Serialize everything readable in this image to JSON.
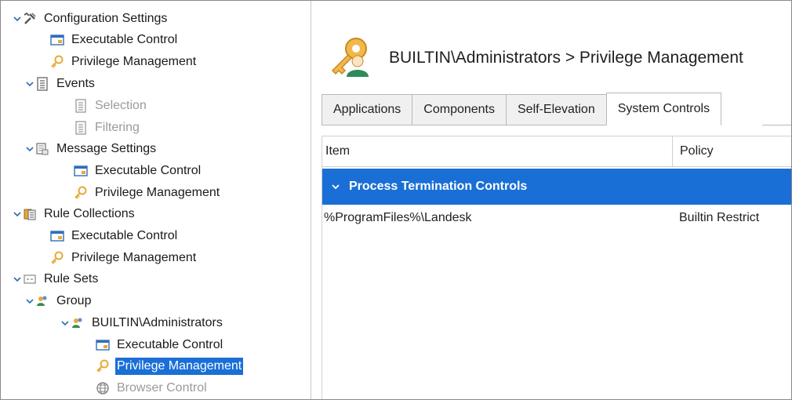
{
  "tree": {
    "config_settings": "Configuration Settings",
    "executable_control_1": "Executable Control",
    "privilege_management_1": "Privilege Management",
    "events": "Events",
    "selection": "Selection",
    "filtering": "Filtering",
    "message_settings": "Message Settings",
    "executable_control_2": "Executable Control",
    "privilege_management_2": "Privilege Management",
    "rule_collections": "Rule Collections",
    "executable_control_3": "Executable Control",
    "privilege_management_3": "Privilege Management",
    "rule_sets": "Rule Sets",
    "group": "Group",
    "builtin_admins": "BUILTIN\\Administrators",
    "executable_control_4": "Executable Control",
    "privilege_management_4": "Privilege Management",
    "browser_control": "Browser Control"
  },
  "header": {
    "title": "BUILTIN\\Administrators > Privilege Management"
  },
  "tabs": [
    "Applications",
    "Components",
    "Self-Elevation",
    "System Controls"
  ],
  "table": {
    "columns": [
      "Item",
      "Policy"
    ],
    "group_label": "Process Termination Controls",
    "rows": [
      {
        "item": "%ProgramFiles%\\Landesk",
        "policy": "Builtin Restrict"
      }
    ]
  },
  "colors": {
    "selection_blue": "#1a6fd6",
    "key_icon_gold": "#e8a93a"
  }
}
